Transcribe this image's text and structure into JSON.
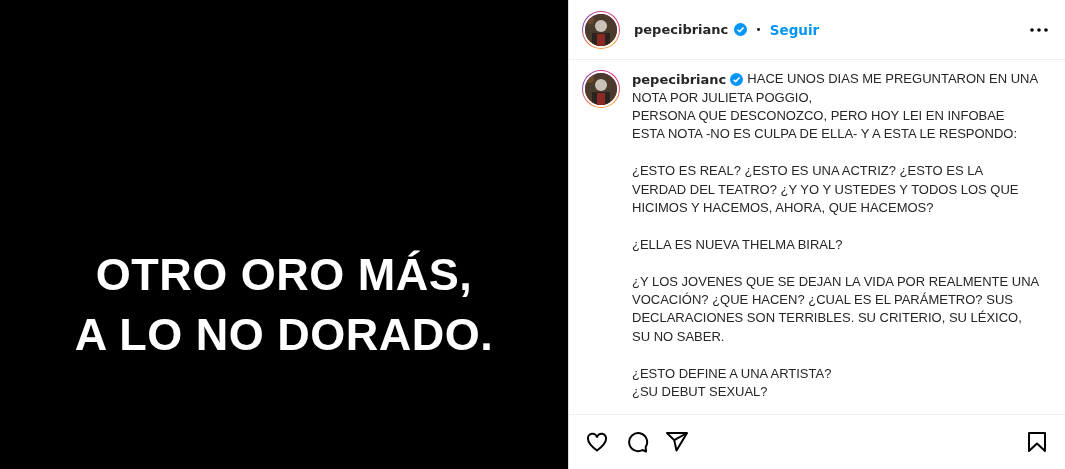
{
  "post_image": {
    "lines": [
      "OTRO ORO MÁS,",
      "A LO NO DORADO."
    ]
  },
  "header": {
    "username": "pepecibrianc",
    "verified": true,
    "separator": "•",
    "follow": "Seguir"
  },
  "caption": {
    "username": "pepecibrianc",
    "verified": true,
    "lead": "HACE UNOS DIAS ME PREGUNTARON EN UNA",
    "paragraphs": [
      "NOTA POR JULIETA POGGIO,\nPERSONA QUE DESCONOZCO, PERO HOY LEI EN INFOBAE ESTA NOTA -NO ES CULPA DE ELLA- Y A ESTA LE RESPONDO:",
      "¿ESTO ES REAL? ¿ESTO ES UNA ACTRIZ? ¿ESTO ES LA VERDAD DEL TEATRO? ¿Y YO Y USTEDES Y TODOS LOS QUE HICIMOS Y HACEMOS, AHORA, QUE HACEMOS?",
      "¿ELLA ES NUEVA THELMA BIRAL?",
      "¿Y LOS JOVENES QUE SE DEJAN LA VIDA POR REALMENTE UNA VOCACIÓN? ¿QUE HACEN? ¿CUAL ES EL PARÁMETRO? SUS DECLARACIONES SON TERRIBLES. SU CRITERIO, SU LÉXICO, SU NO SABER.",
      "¿ESTO DEFINE A UNA ARTISTA?\n¿SU DEBUT SEXUAL?"
    ]
  },
  "actions": [
    {
      "kind": "like"
    },
    {
      "kind": "comment"
    },
    {
      "kind": "share"
    },
    {
      "kind": "save"
    }
  ]
}
